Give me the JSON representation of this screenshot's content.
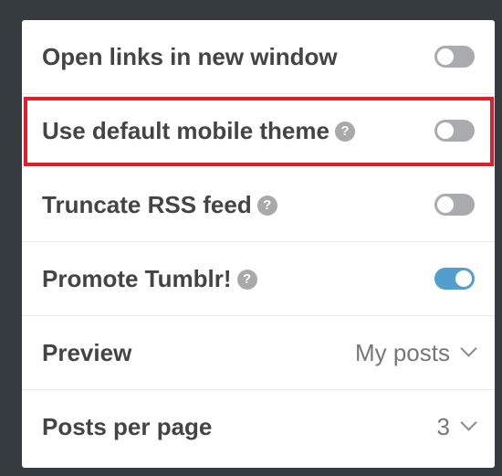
{
  "settings": {
    "open_links": {
      "label": "Open links in new window",
      "enabled": false
    },
    "mobile_theme": {
      "label": "Use default mobile theme",
      "help_icon": "?",
      "enabled": false
    },
    "truncate_rss": {
      "label": "Truncate RSS feed",
      "help_icon": "?",
      "enabled": false
    },
    "promote": {
      "label": "Promote Tumblr!",
      "help_icon": "?",
      "enabled": true
    },
    "preview": {
      "label": "Preview",
      "value": "My posts"
    },
    "posts_per_page": {
      "label": "Posts per page",
      "value": "3"
    }
  },
  "highlight_color": "#e21d27",
  "accent_color": "#529ecc"
}
